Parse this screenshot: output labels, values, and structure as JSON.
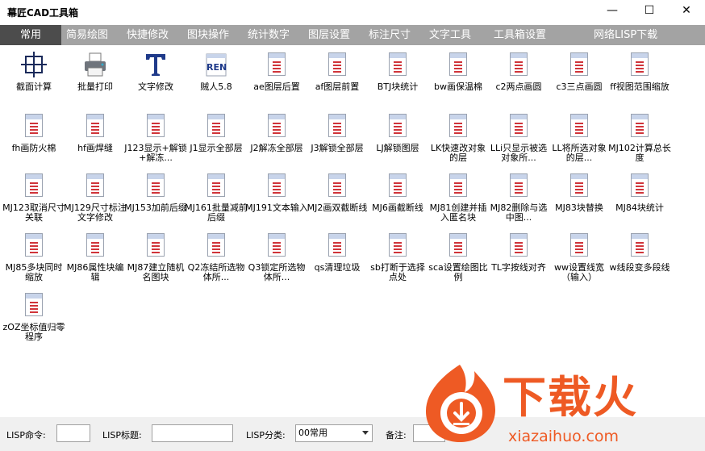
{
  "window": {
    "title": "幕匠CAD工具箱",
    "minimize": "—",
    "maximize": "☐",
    "close": "✕"
  },
  "tabs": [
    {
      "label": "常用"
    },
    {
      "label": "简易绘图"
    },
    {
      "label": "快捷修改"
    },
    {
      "label": "图块操作"
    },
    {
      "label": "统计数字"
    },
    {
      "label": "图层设置"
    },
    {
      "label": "标注尺寸"
    },
    {
      "label": "文字工具"
    },
    {
      "label": "工具箱设置"
    },
    {
      "label": "网络LISP下载"
    }
  ],
  "items": [
    {
      "label": "截面计算",
      "icon": "crosshair-grid-icon"
    },
    {
      "label": "批量打印",
      "icon": "printer-icon"
    },
    {
      "label": "文字修改",
      "icon": "text-t-icon"
    },
    {
      "label": "贼人5.8",
      "icon": "ren-file-icon",
      "icon_text": "REN"
    },
    {
      "label": "ae图层后置",
      "icon": "lisp-file-icon"
    },
    {
      "label": "af图层前置",
      "icon": "lisp-file-icon"
    },
    {
      "label": "BTJ块统计",
      "icon": "lisp-file-icon"
    },
    {
      "label": "bw画保温棉",
      "icon": "lisp-file-icon"
    },
    {
      "label": "c2两点画圆",
      "icon": "lisp-file-icon"
    },
    {
      "label": "c3三点画圆",
      "icon": "lisp-file-icon"
    },
    {
      "label": "ff视图范围缩放",
      "icon": "lisp-file-icon"
    },
    {
      "label": "fh画防火棉",
      "icon": "lisp-file-icon"
    },
    {
      "label": "hf画焊缝",
      "icon": "lisp-file-icon"
    },
    {
      "label": "J123显示+解锁+解冻...",
      "icon": "lisp-file-icon"
    },
    {
      "label": "J1显示全部层",
      "icon": "lisp-file-icon"
    },
    {
      "label": "J2解冻全部层",
      "icon": "lisp-file-icon"
    },
    {
      "label": "J3解锁全部层",
      "icon": "lisp-file-icon"
    },
    {
      "label": "LJ解锁图层",
      "icon": "lisp-file-icon"
    },
    {
      "label": "LK快速改对象的层",
      "icon": "lisp-file-icon"
    },
    {
      "label": "LLi只显示被选对象所...",
      "icon": "lisp-file-icon"
    },
    {
      "label": "LL将所选对象的层...",
      "icon": "lisp-file-icon"
    },
    {
      "label": "MJ102计算总长度",
      "icon": "lisp-file-icon"
    },
    {
      "label": "MJ123取消尺寸关联",
      "icon": "lisp-file-icon"
    },
    {
      "label": "MJ129尺寸标注文字修改",
      "icon": "lisp-file-icon"
    },
    {
      "label": "MJ153加前后缀",
      "icon": "lisp-file-icon"
    },
    {
      "label": "MJ161批量减前后缀",
      "icon": "lisp-file-icon"
    },
    {
      "label": "MJ191文本输入",
      "icon": "lisp-file-icon"
    },
    {
      "label": "MJ2画双截断线",
      "icon": "lisp-file-icon"
    },
    {
      "label": "MJ6画截断线",
      "icon": "lisp-file-icon"
    },
    {
      "label": "MJ81创建并插入匿名块",
      "icon": "lisp-file-icon"
    },
    {
      "label": "MJ82删除与选中图...",
      "icon": "lisp-file-icon"
    },
    {
      "label": "MJ83块替换",
      "icon": "lisp-file-icon"
    },
    {
      "label": "MJ84块统计",
      "icon": "lisp-file-icon"
    },
    {
      "label": "MJ85多块同时缩放",
      "icon": "lisp-file-icon"
    },
    {
      "label": "MJ86属性块编辑",
      "icon": "lisp-file-icon"
    },
    {
      "label": "MJ87建立随机名图块",
      "icon": "lisp-file-icon"
    },
    {
      "label": "Q2冻结所选物体所...",
      "icon": "lisp-file-icon"
    },
    {
      "label": "Q3锁定所选物体所...",
      "icon": "lisp-file-icon"
    },
    {
      "label": "qs清理垃圾",
      "icon": "lisp-file-icon"
    },
    {
      "label": "sb打断于选择点处",
      "icon": "lisp-file-icon"
    },
    {
      "label": "sca设置绘图比例",
      "icon": "lisp-file-icon"
    },
    {
      "label": "TL字按线对齐",
      "icon": "lisp-file-icon"
    },
    {
      "label": "ww设置线宽（输入）",
      "icon": "lisp-file-icon"
    },
    {
      "label": "w线段变多段线",
      "icon": "lisp-file-icon"
    },
    {
      "label": "zOZ坐标值归零程序",
      "icon": "lisp-file-icon"
    }
  ],
  "bottom": {
    "command_label": "LISP命令:",
    "command_value": "",
    "title_label": "LISP标题:",
    "title_value": "",
    "category_label": "LISP分类:",
    "category_value": "00常用",
    "note_label": "备注:",
    "note_value": ""
  },
  "watermark": {
    "text": "下载火",
    "url": "xiazaihuo.com"
  },
  "colors": {
    "tab_bar": "#a3a3a3",
    "tab_active": "#4c4c4c",
    "doc_lines": "#d0343a",
    "watermark": "#ee5a24"
  }
}
